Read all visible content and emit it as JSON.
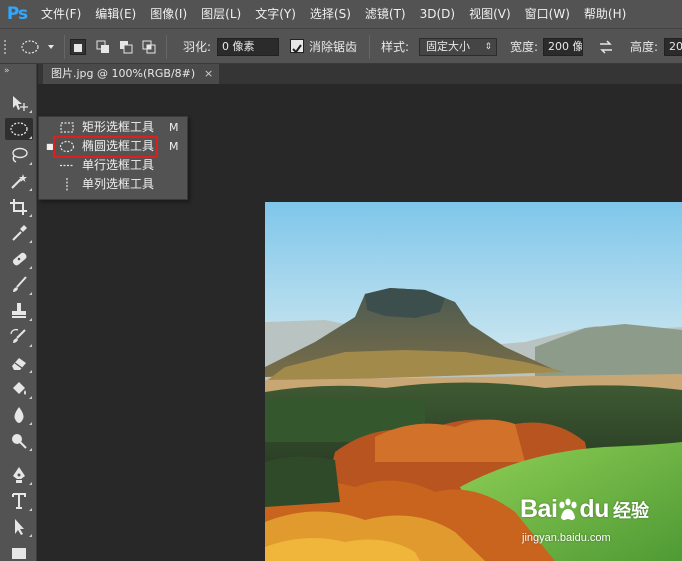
{
  "app": {
    "logo": "Ps"
  },
  "menu": [
    "文件(F)",
    "编辑(E)",
    "图像(I)",
    "图层(L)",
    "文字(Y)",
    "选择(S)",
    "滤镜(T)",
    "3D(D)",
    "视图(V)",
    "窗口(W)",
    "帮助(H)"
  ],
  "options": {
    "feather_label": "羽化:",
    "feather_value": "0 像素",
    "antialias_label": "消除锯齿",
    "antialias_checked": true,
    "style_label": "样式:",
    "style_value": "固定大小",
    "width_label": "宽度:",
    "width_value": "200 像",
    "height_label": "高度:",
    "height_value": "200"
  },
  "document_tab": {
    "title": "图片.jpg @ 100%(RGB/8#)",
    "close": "×"
  },
  "tools": [
    {
      "icon": "move-icon",
      "glyph": "▸"
    },
    {
      "icon": "elliptical-marquee-icon",
      "glyph": "◯"
    },
    {
      "icon": "lasso-icon",
      "glyph": "ℓ"
    },
    {
      "icon": "magic-wand-icon",
      "glyph": "✲"
    },
    {
      "icon": "crop-icon",
      "glyph": "⌗"
    },
    {
      "icon": "eyedropper-icon",
      "glyph": "✎"
    },
    {
      "icon": "healing-brush-icon",
      "glyph": "✚"
    },
    {
      "icon": "brush-icon",
      "glyph": "✏"
    },
    {
      "icon": "clone-stamp-icon",
      "glyph": "⊥"
    },
    {
      "icon": "history-brush-icon",
      "glyph": "↺"
    },
    {
      "icon": "eraser-icon",
      "glyph": "▭"
    },
    {
      "icon": "paint-bucket-icon",
      "glyph": "♦"
    },
    {
      "icon": "blur-icon",
      "glyph": "●"
    },
    {
      "icon": "dodge-icon",
      "glyph": "○"
    },
    {
      "icon": "pen-icon",
      "glyph": "✒"
    },
    {
      "icon": "type-icon",
      "glyph": "T"
    },
    {
      "icon": "path-selection-icon",
      "glyph": "➤"
    },
    {
      "icon": "rectangle-shape-icon",
      "glyph": "■"
    }
  ],
  "flyout": [
    {
      "label": "矩形选框工具",
      "key": "M",
      "selected": false,
      "icon": "rectangular-marquee-icon"
    },
    {
      "label": "椭圆选框工具",
      "key": "M",
      "selected": true,
      "icon": "elliptical-marquee-icon"
    },
    {
      "label": "单行选框工具",
      "key": "",
      "selected": false,
      "icon": "single-row-marquee-icon"
    },
    {
      "label": "单列选框工具",
      "key": "",
      "selected": false,
      "icon": "single-column-marquee-icon"
    }
  ],
  "watermark": {
    "brand": "Bai",
    "brand2": "百",
    "brand3": "du",
    "cn": "经验",
    "url": "jingyan.baidu.com"
  },
  "colors": {
    "ui_bg": "#535353",
    "canvas": "#282828",
    "highlight": "#e01e1e",
    "ps_blue": "#31a8ff"
  }
}
